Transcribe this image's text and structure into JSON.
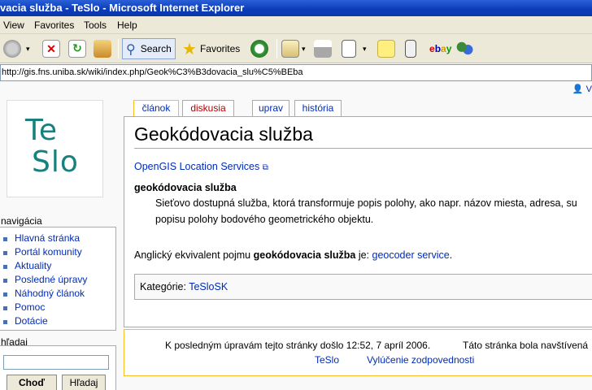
{
  "window": {
    "title": "vacia služba - TeSlo - Microsoft Internet Explorer"
  },
  "menu": [
    "View",
    "Favorites",
    "Tools",
    "Help"
  ],
  "toolbar": {
    "search_label": "Search",
    "favorites_label": "Favorites"
  },
  "address": {
    "url": "http://gis.fns.uniba.sk/wiki/index.php/Geok%C3%B3dovacia_slu%C5%BEba"
  },
  "user_link": "V",
  "logo": {
    "line1": "Te",
    "line2": "Slo"
  },
  "tabs": [
    {
      "label": "článok",
      "color": "#002bb8"
    },
    {
      "label": "diskusia",
      "color": "#ba0000"
    },
    {
      "label": "uprav",
      "color": "#002bb8"
    },
    {
      "label": "história",
      "color": "#002bb8"
    }
  ],
  "article": {
    "title": "Geokódovacia služba",
    "external_link": "OpenGIS Location Services",
    "term": "geokódovacia služba",
    "definition_line1": "Sieťovo dostupná služba, ktorá transformuje popis polohy, ako napr. názov miesta, adresa, su",
    "definition_line2": "popisu polohy bodového geometrického objektu.",
    "english_prefix": "Anglický ekvivalent pojmu ",
    "english_term": "geokódovacia služba",
    "english_middle": " je: ",
    "english_link": "geocoder service",
    "english_suffix": ".",
    "category_label": "Kategórie: ",
    "category_link": "TeSloSK"
  },
  "footer": {
    "last_modified": "K posledným úpravám tejto stránky došlo 12:52, 7 apríl 2006.",
    "visited": "Táto stránka bola navštívená",
    "link_teslo": "TeSlo",
    "link_disclaimer": "Vylúčenie zodpovednosti"
  },
  "navigation": {
    "title": "navigácia",
    "items": [
      "Hlavná stránka",
      "Portál komunity",
      "Aktuality",
      "Posledné úpravy",
      "Náhodný článok",
      "Pomoc",
      "Dotácie"
    ]
  },
  "search": {
    "title": "hľadaj",
    "go_button": "Choď",
    "search_button": "Hľadaj"
  }
}
